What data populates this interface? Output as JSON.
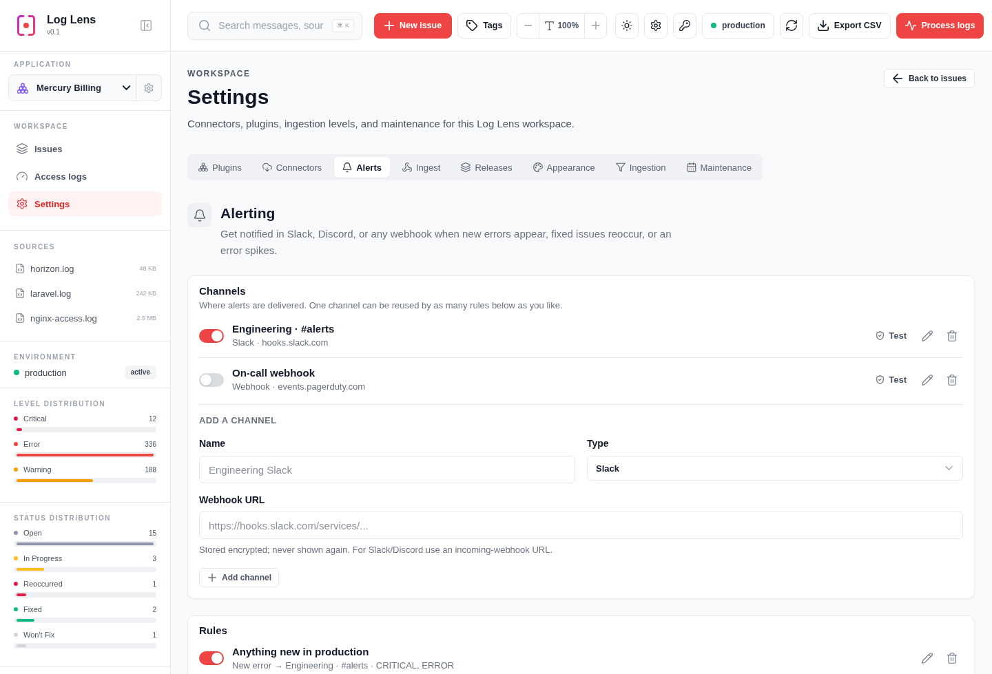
{
  "app": {
    "name": "Log Lens",
    "version": "v0.1"
  },
  "sidebar": {
    "application": {
      "heading": "APPLICATION",
      "current": "Mercury Billing"
    },
    "workspace": {
      "heading": "WORKSPACE",
      "items": [
        {
          "label": "Issues",
          "selected": false
        },
        {
          "label": "Access logs",
          "selected": false
        },
        {
          "label": "Settings",
          "selected": true
        }
      ]
    },
    "sources": {
      "heading": "SOURCES",
      "items": [
        {
          "name": "horizon.log",
          "size": "48 KB"
        },
        {
          "name": "laravel.log",
          "size": "242 KB"
        },
        {
          "name": "nginx-access.log",
          "size": "2.5 MB"
        }
      ]
    },
    "environment": {
      "heading": "ENVIRONMENT",
      "name": "production",
      "badge": "active"
    },
    "level_distribution": {
      "heading": "LEVEL DISTRIBUTION",
      "items": [
        {
          "name": "Critical",
          "count": "12",
          "level": 0.04,
          "color": "#e11d48"
        },
        {
          "name": "Error",
          "count": "336",
          "level": 1,
          "color": "#ef4444"
        },
        {
          "name": "Warning",
          "count": "188",
          "level": 0.56,
          "color": "#f59e0b"
        }
      ]
    },
    "status_distribution": {
      "heading": "STATUS DISTRIBUTION",
      "items": [
        {
          "name": "Open",
          "count": "15",
          "level": 1,
          "color": "#8e95aa"
        },
        {
          "name": "In Progress",
          "count": "3",
          "level": 0.2,
          "color": "#fbbf24"
        },
        {
          "name": "Reoccurred",
          "count": "1",
          "level": 0.07,
          "color": "#e11d48"
        },
        {
          "name": "Fixed",
          "count": "2",
          "level": 0.13,
          "color": "#10b981"
        },
        {
          "name": "Won't Fix",
          "count": "1",
          "level": 0.07,
          "color": "#d1d5db"
        }
      ]
    }
  },
  "toolbar": {
    "search": {
      "placeholder": "Search messages, sour",
      "shortcut": "⌘ K"
    },
    "new_issue": "New issue",
    "tags": "Tags",
    "zoom": "100%",
    "environment": "production",
    "export": "Export CSV",
    "process": "Process logs"
  },
  "page": {
    "eyebrow": "WORKSPACE",
    "title": "Settings",
    "description": "Connectors, plugins, ingestion levels, and maintenance for this Log Lens workspace.",
    "back": "Back to issues"
  },
  "tabs": [
    {
      "label": "Plugins",
      "selected": false
    },
    {
      "label": "Connectors",
      "selected": false
    },
    {
      "label": "Alerts",
      "selected": true
    },
    {
      "label": "Ingest",
      "selected": false
    },
    {
      "label": "Releases",
      "selected": false
    },
    {
      "label": "Appearance",
      "selected": false
    },
    {
      "label": "Ingestion",
      "selected": false
    },
    {
      "label": "Maintenance",
      "selected": false
    }
  ],
  "section": {
    "title": "Alerting",
    "description": "Get notified in Slack, Discord, or any webhook when new errors appear, fixed issues reoccur, or an error spikes."
  },
  "channels": {
    "title": "Channels",
    "subtitle": "Where alerts are delivered. One channel can be reused by as many rules below as you like.",
    "items": [
      {
        "name": "Engineering · #alerts",
        "detail": "Slack · hooks.slack.com",
        "on": true,
        "test": "Test"
      },
      {
        "name": "On-call webhook",
        "detail": "Webhook · events.pagerduty.com",
        "on": false,
        "test": "Test"
      }
    ],
    "add": {
      "heading": "ADD A CHANNEL",
      "name_field": {
        "label": "Name",
        "placeholder": "Engineering Slack"
      },
      "type_field": {
        "label": "Type",
        "value": "Slack"
      },
      "url_field": {
        "label": "Webhook URL",
        "placeholder": "https://hooks.slack.com/services/..."
      },
      "hint": "Stored encrypted; never shown again. For Slack/Discord use an incoming-webhook URL.",
      "button": "Add channel"
    }
  },
  "rules": {
    "title": "Rules",
    "items": [
      {
        "name": "Anything new in production",
        "detail": "New error → Engineering · #alerts · CRITICAL, ERROR",
        "on": true
      }
    ]
  }
}
